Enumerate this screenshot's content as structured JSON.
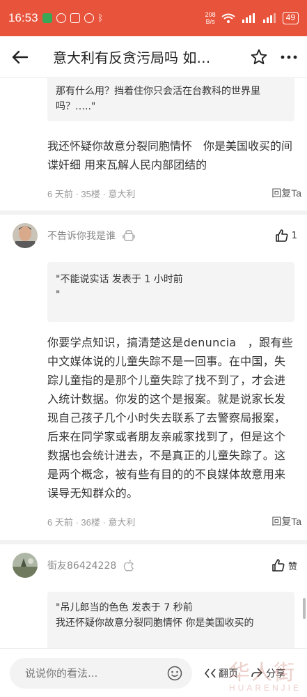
{
  "status_bar": {
    "time": "16:53",
    "net_speed_value": "208",
    "net_speed_unit": "B/s",
    "battery": "49"
  },
  "header": {
    "title": "意大利有反贪污局吗 如…"
  },
  "comments": [
    {
      "quote": "那有什么用？挡着住你只会活在台教科的世界里吗？…..\"",
      "body": "我还怀疑你故意分裂同胞情怀　你是美国收买的间谍奸细 用来瓦解人民内部团结的",
      "meta": "6 天前 · 35楼 · 意大利",
      "reply": "回复Ta"
    },
    {
      "username": "不告诉你我是谁",
      "likes": "1",
      "quote": "\"不能说实话 发表于 1 小时前\n\"",
      "body": "你要学点知识，搞清楚这是denuncia　，跟有些中文媒体说的儿童失踪不是一回事。在中国，失踪儿童指的是那个儿童失踪了找不到了，才会进入统计数据。你发的这个是报案。就是说家长发现自己孩子几个小时失去联系了去警察局报案，后来在同学家或者朋友亲戚家找到了，但是这个数据也会统计进去，不是真正的儿童失踪了。这是两个概念，被有些有目的的不良媒体故意用来误导无知群众的。",
      "meta": "6 天前 · 36楼 · 意大利",
      "reply": "回复Ta"
    },
    {
      "username": "街友86424228",
      "likes": "赞",
      "quote": "\"吊儿郎当的色色 发表于 7 秒前\n我还怀疑你故意分裂同胞情怀 你是美国收买的"
    }
  ],
  "bottom_bar": {
    "input_placeholder": "说说你的看法...",
    "page_label": "翻页",
    "share_label": "分享"
  },
  "watermark": {
    "cn": "华人街",
    "en": "HUARENJIE"
  }
}
